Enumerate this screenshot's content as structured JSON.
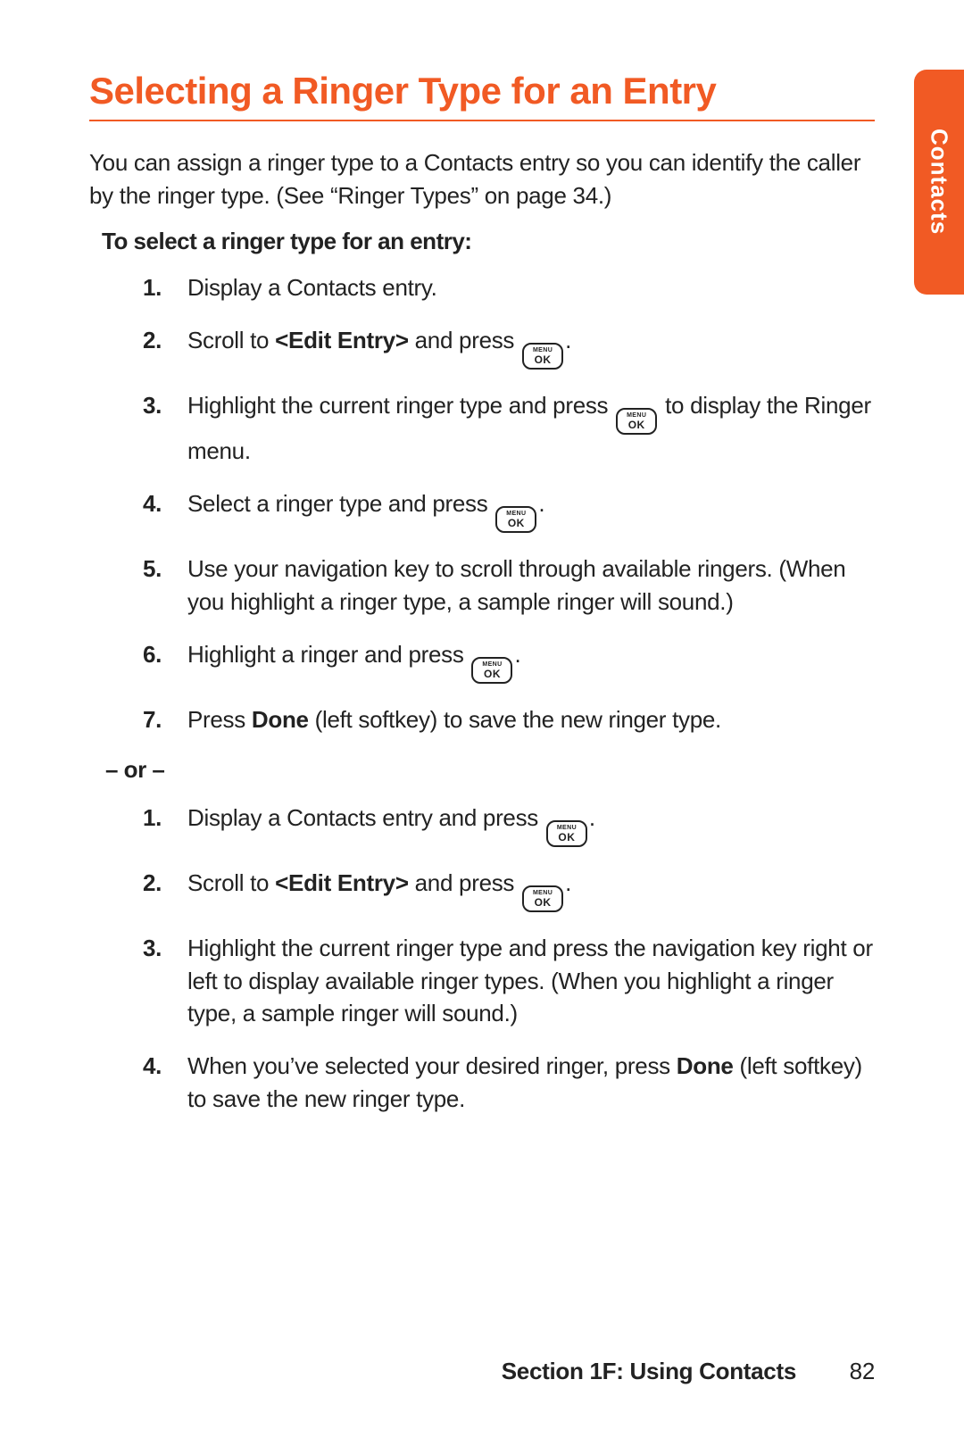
{
  "accent": "#f15a24",
  "side_tab": {
    "label": "Contacts"
  },
  "title": "Selecting a Ringer  Type for an Entry",
  "intro": "You  can assign a ringer type to a Contacts entry so you can identify the caller by the ringer type. (See “Ringer Types” on page 34.)",
  "subhead": "To select a ringer type for an entry:",
  "key": {
    "menu": "MENU",
    "ok": "OK"
  },
  "steps_a": {
    "s1": "Display a Contacts entry.",
    "s2_a": "Scroll to ",
    "s2_bold": "<Edit Entry>",
    "s2_b": " and press ",
    "s2_c": ".",
    "s3_a": "Highlight the current ringer type and press ",
    "s3_b": " to display the Ringer menu.",
    "s4_a": "Select a ringer type and press ",
    "s4_b": ".",
    "s5": "Use your navigation key to scroll through available ringers. (When you highlight a ringer type, a sample ringer will sound.)",
    "s6_a": "Highlight a ringer and press ",
    "s6_b": ".",
    "s7_a": "Press ",
    "s7_bold": "Done",
    "s7_b": " (left softkey) to save the new ringer type."
  },
  "or_sep": "– or –",
  "steps_b": {
    "s1_a": "Display a Contacts entry and press ",
    "s1_b": ".",
    "s2_a": "Scroll to ",
    "s2_bold": "<Edit Entry>",
    "s2_b": " and press ",
    "s2_c": ".",
    "s3": "Highlight the current ringer type and press the navigation key right or left to display available ringer types. (When you highlight a ringer type, a sample ringer will sound.)",
    "s4_a": "When you’ve selected your desired ringer, press ",
    "s4_bold": "Done",
    "s4_b": " (left softkey) to save the new ringer type."
  },
  "footer": {
    "section": "Section 1F: Using Contacts",
    "page": "82"
  }
}
